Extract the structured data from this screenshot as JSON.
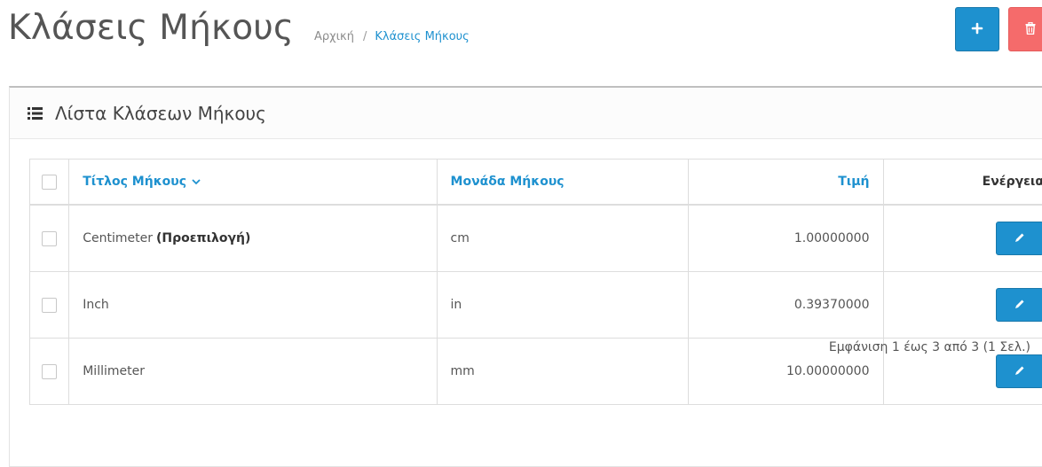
{
  "header": {
    "title": "Κλάσεις Μήκους",
    "breadcrumb": [
      {
        "label": "Αρχική"
      },
      {
        "label": "Κλάσεις Μήκους"
      }
    ],
    "separator": "/",
    "add_button_icon": "plus-icon",
    "delete_button_icon": "trash-icon"
  },
  "panel": {
    "title": "Λίστα Κλάσεων Μήκους",
    "icon": "list-icon"
  },
  "table": {
    "columns": {
      "title": "Τίτλος Μήκους",
      "unit": "Μονάδα Μήκους",
      "value": "Τιμή",
      "action": "Ενέργεια"
    },
    "rows": [
      {
        "title": "Centimeter",
        "default_label": "(Προεπιλογή)",
        "unit": "cm",
        "value": "1.00000000"
      },
      {
        "title": "Inch",
        "unit": "in",
        "value": "0.39370000"
      },
      {
        "title": "Millimeter",
        "unit": "mm",
        "value": "10.00000000"
      }
    ]
  },
  "pagination": {
    "info": "Εμφάνιση 1 έως 3 από 3 (1 Σελ.)"
  },
  "colors": {
    "primary": "#1e91cf",
    "danger": "#f56b6b"
  }
}
